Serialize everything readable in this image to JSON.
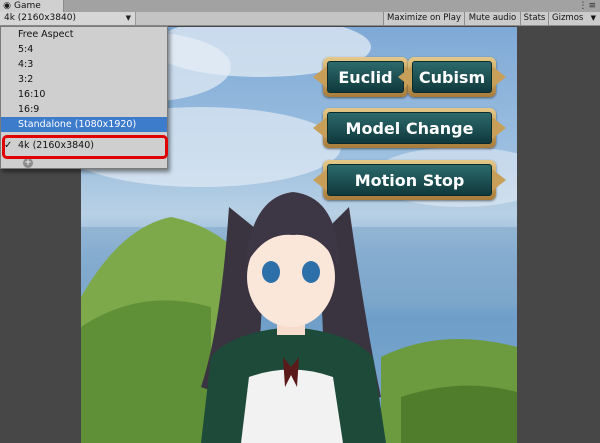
{
  "window": {
    "tab_title": "Game",
    "tab_icon": "game-controller-icon",
    "tab_menu_icon": "window-menu-icon"
  },
  "toolbar": {
    "aspect_value": "4k (2160x3840)",
    "maximize_label": "Maximize on Play",
    "mute_label": "Mute audio",
    "stats_label": "Stats",
    "gizmos_label": "Gizmos"
  },
  "aspect_dropdown": {
    "items": [
      {
        "label": "Free Aspect"
      },
      {
        "label": "5:4"
      },
      {
        "label": "4:3"
      },
      {
        "label": "3:2"
      },
      {
        "label": "16:10"
      },
      {
        "label": "16:9"
      },
      {
        "label": "Standalone (1080x1920)"
      },
      {
        "label": "4k (2160x3840)"
      }
    ],
    "hovered_index": 6,
    "checked_index": 7,
    "add_icon": "add-circle-icon"
  },
  "game_ui": {
    "euclid_label": "Euclid",
    "cubism_label": "Cubism",
    "model_change_label": "Model Change",
    "motion_stop_label": "Motion Stop"
  },
  "colors": {
    "highlight": "#e00000",
    "selected_item": "#3d7bcb",
    "button_teal": "#1d5456",
    "button_frame_gold": "#c89f58"
  }
}
